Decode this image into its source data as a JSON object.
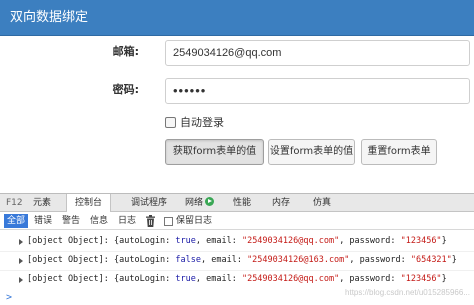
{
  "panel": {
    "title": "双向数据绑定"
  },
  "form": {
    "email_label": "邮箱:",
    "email_value": "2549034126@qq.com",
    "password_label": "密码:",
    "password_value": "••••••",
    "auto_login_label": "自动登录",
    "auto_login_checked": false,
    "buttons": {
      "get": "获取form表单的值",
      "set": "设置form表单的值",
      "reset": "重置form表单"
    }
  },
  "devtools": {
    "tabs": {
      "f12": "F12",
      "elements": "元素",
      "console": "控制台",
      "debugger": "调试程序",
      "network": "网络",
      "performance": "性能",
      "memory": "内存",
      "emulation": "仿真"
    },
    "filters": {
      "all": "全部",
      "errors": "错误",
      "warnings": "警告",
      "info": "信息",
      "log": "日志",
      "preserve_log": "保留日志"
    },
    "logs": [
      {
        "prefix": "[object Object]: {autoLogin: ",
        "auto": "true",
        "mid": ", email: ",
        "email": "\"2549034126@qq.com\"",
        "pwmid": ", password: ",
        "password": "\"123456\"",
        "suffix": "}"
      },
      {
        "prefix": "[object Object]: {autoLogin: ",
        "auto": "false",
        "mid": ", email: ",
        "email": "\"2549034126@163.com\"",
        "pwmid": ", password: ",
        "password": "\"654321\"",
        "suffix": "}"
      },
      {
        "prefix": "[object Object]: {autoLogin: ",
        "auto": "true",
        "mid": ", email: ",
        "email": "\"2549034126@qq.com\"",
        "pwmid": ", password: ",
        "password": "\"123456\"",
        "suffix": "}"
      }
    ],
    "prompt": ">",
    "watermark": "https://blog.csdn.net/u015285966..."
  }
}
